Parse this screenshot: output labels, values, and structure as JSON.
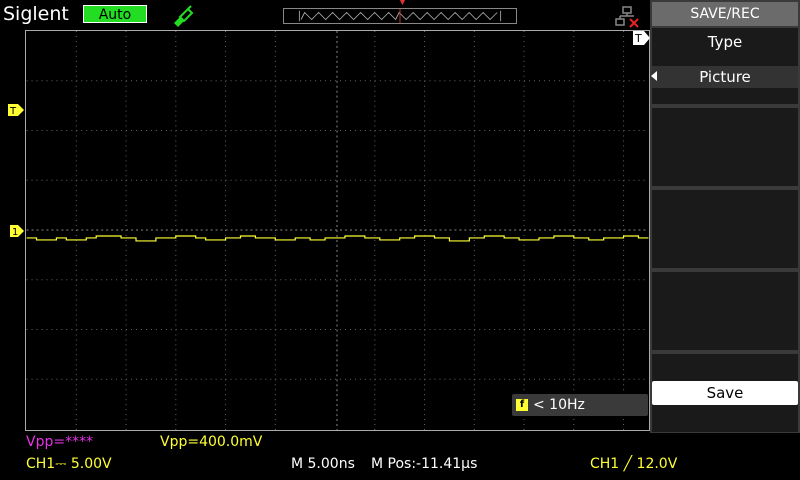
{
  "header": {
    "brand": "Siglent",
    "mode": "Auto"
  },
  "colors": {
    "ch1": "#ffff33",
    "ch2": "#e633e6",
    "mode_badge": "#22dd22",
    "grid": "#aaaaaa"
  },
  "markers": {
    "ch1": "1",
    "trigger_level": "T",
    "trigger_time": "T"
  },
  "measurement": {
    "freq_icon": "f",
    "freq_text": "< 10Hz"
  },
  "menu": {
    "title": "SAVE/REC",
    "type_label": "Type",
    "type_value": "Picture",
    "save_label": "Save"
  },
  "status": {
    "vpp_ch2": "Vpp=****",
    "vpp_ch1": "Vpp=400.0mV",
    "ch1_scale": "CH1⎓ 5.00V",
    "timebase": "M 5.00ns",
    "mpos": "M Pos:-11.41µs",
    "trigger": "CH1 ╱ 12.0V"
  },
  "icons": [
    "probe-icon",
    "network-icon",
    "trigger-position-icon"
  ]
}
